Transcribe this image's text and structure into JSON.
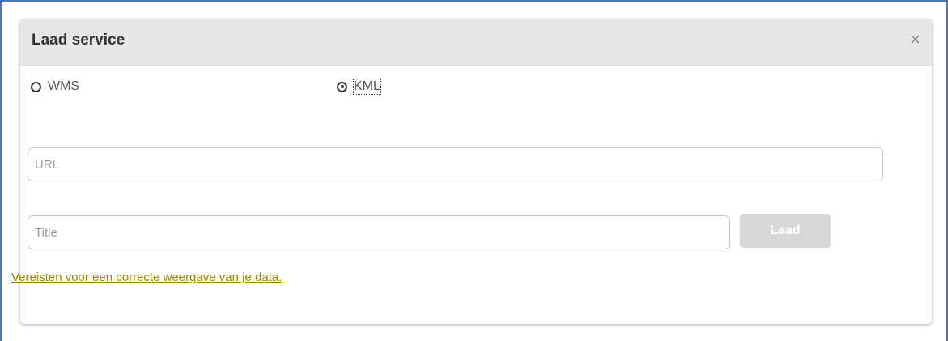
{
  "dialog": {
    "title": "Laad service",
    "close_label": "×"
  },
  "service_type": {
    "options": [
      {
        "label": "WMS",
        "selected": false
      },
      {
        "label": "KML",
        "selected": true
      }
    ]
  },
  "form": {
    "url_placeholder": "URL",
    "title_placeholder": "Title",
    "submit_label": "Laad"
  },
  "requirements_link": "Vereisten voor een correcte weergave van je data.",
  "colors": {
    "accent_link": "#a08600",
    "frame_border": "#4a78b4",
    "header_bg": "#e6e6e6",
    "disabled_button_bg": "#d7d7d7"
  }
}
